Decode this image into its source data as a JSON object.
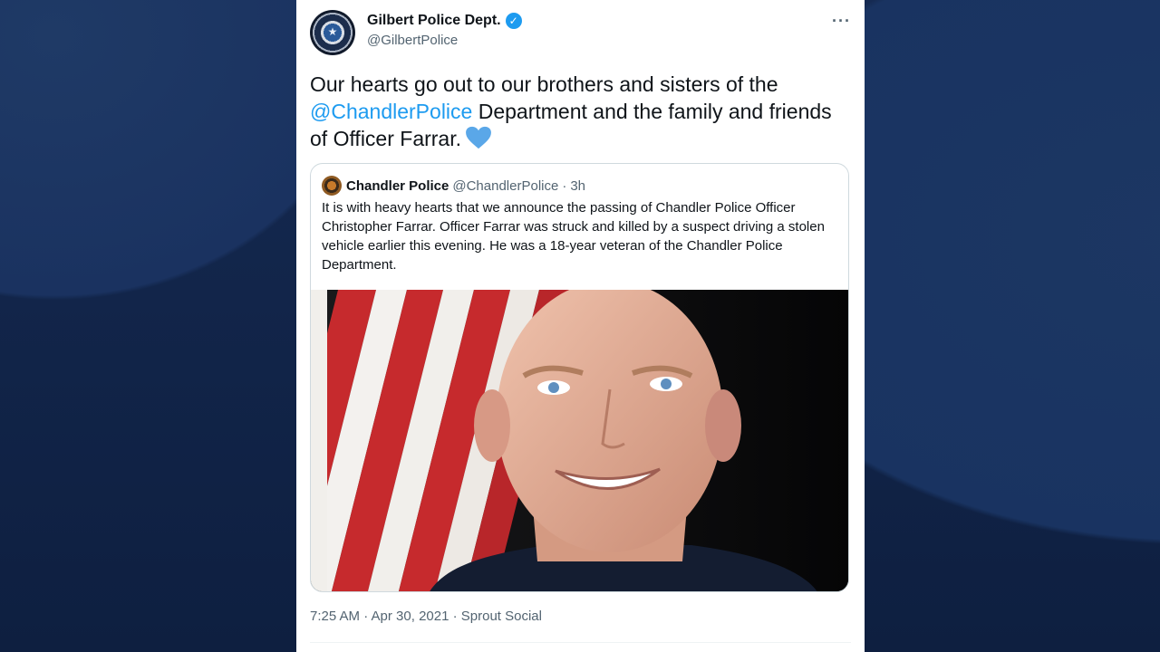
{
  "tweet": {
    "display_name": "Gilbert Police Dept.",
    "handle": "@GilbertPolice",
    "verified_icon": "verified-badge-icon",
    "more_icon": "···",
    "text_part1": "Our hearts go out to our brothers and sisters of the ",
    "mention": "@ChandlerPolice",
    "text_part2": " Department and the family and friends of Officer Farrar.",
    "emoji": "blue-heart",
    "timestamp": "7:25 AM · Apr 30, 2021 · Sprout Social"
  },
  "quoted": {
    "display_name": "Chandler Police",
    "handle": "@ChandlerPolice",
    "separator": "·",
    "time": "3h",
    "text": "It is with heavy hearts that we announce the passing of Chandler Police Officer Christopher Farrar. Officer Farrar was struck and killed by a suspect driving a stolen vehicle earlier this evening. He was a 18-year veteran of the Chandler Police Department."
  },
  "colors": {
    "accent": "#1d9bf0",
    "heart": "#5aa7e8",
    "background": "#0f2244"
  }
}
